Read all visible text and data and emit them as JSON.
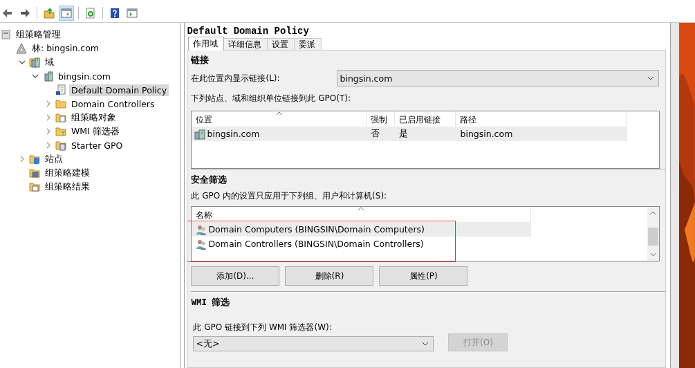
{
  "toolbar": {
    "buttons": [
      {
        "kind": "back",
        "pressed": false
      },
      {
        "kind": "forward",
        "pressed": false
      },
      {
        "kind": "up",
        "pressed": false
      },
      {
        "kind": "tree",
        "pressed": true
      },
      {
        "kind": "refresh",
        "pressed": false
      },
      {
        "kind": "help",
        "pressed": false
      },
      {
        "kind": "pane",
        "pressed": false
      }
    ]
  },
  "tree": [
    {
      "label": "组策略管理",
      "kind": "root",
      "selected": false,
      "children": [
        {
          "label": "林: bingsin.com",
          "kind": "forest",
          "selected": false,
          "children": [
            {
              "label": "域",
              "kind": "domains",
              "expanded": true,
              "selected": false,
              "children": [
                {
                  "label": "bingsin.com",
                  "kind": "domain",
                  "expanded": true,
                  "selected": false,
                  "children": [
                    {
                      "label": "Default Domain Policy",
                      "kind": "gpo",
                      "selected": true
                    },
                    {
                      "label": "Domain Controllers",
                      "kind": "ou",
                      "expanded": false,
                      "selected": false
                    },
                    {
                      "label": "组策略对象",
                      "kind": "folder",
                      "expanded": false,
                      "selected": false
                    },
                    {
                      "label": "WMI 筛选器",
                      "kind": "filter",
                      "expanded": false,
                      "selected": false
                    },
                    {
                      "label": "Starter GPO",
                      "kind": "starter",
                      "expanded": false,
                      "selected": false
                    }
                  ]
                }
              ]
            },
            {
              "label": "站点",
              "kind": "sites",
              "expanded": false,
              "selected": false
            },
            {
              "label": "组策略建模",
              "kind": "modeling",
              "selected": false
            },
            {
              "label": "组策略结果",
              "kind": "results",
              "selected": false
            }
          ]
        }
      ]
    }
  ],
  "details": {
    "title": "Default Domain Policy",
    "tabs": [
      {
        "label": "作用域",
        "selected": true
      },
      {
        "label": "详细信息",
        "selected": false
      },
      {
        "label": "设置",
        "selected": false
      },
      {
        "label": "委派",
        "selected": false
      }
    ],
    "links": {
      "heading": "链接",
      "location_label": "在此位置内显示链接(L):",
      "location_value": "bingsin.com",
      "list_label": "下列站点、域和组织单位链接到此 GPO(T):",
      "columns": [
        "位置",
        "强制",
        "已启用链接",
        "路径"
      ],
      "rows": [
        {
          "cells": [
            "bingsin.com",
            "否",
            "是",
            "bingsin.com"
          ],
          "selected": true
        }
      ]
    },
    "security": {
      "heading": "安全筛选",
      "label": "此 GPO 内的设置只应用于下列组、用户和计算机(S):",
      "column": "名称",
      "rows": [
        {
          "name": "Domain Computers (BINGSIN\\Domain Computers)",
          "selected": true
        },
        {
          "name": "Domain Controllers (BINGSIN\\Domain Controllers)",
          "selected": false
        }
      ],
      "buttons": [
        {
          "label": "添加(D)...",
          "disabled": false
        },
        {
          "label": "删除(R)",
          "disabled": false
        },
        {
          "label": "属性(P)",
          "disabled": false
        }
      ]
    },
    "wmi": {
      "heading": "WMI 筛选",
      "label": "此 GPO 链接到下列 WMI 筛选器(W):",
      "value": "<无>",
      "open_button": {
        "label": "打开(O)",
        "disabled": true
      }
    }
  }
}
